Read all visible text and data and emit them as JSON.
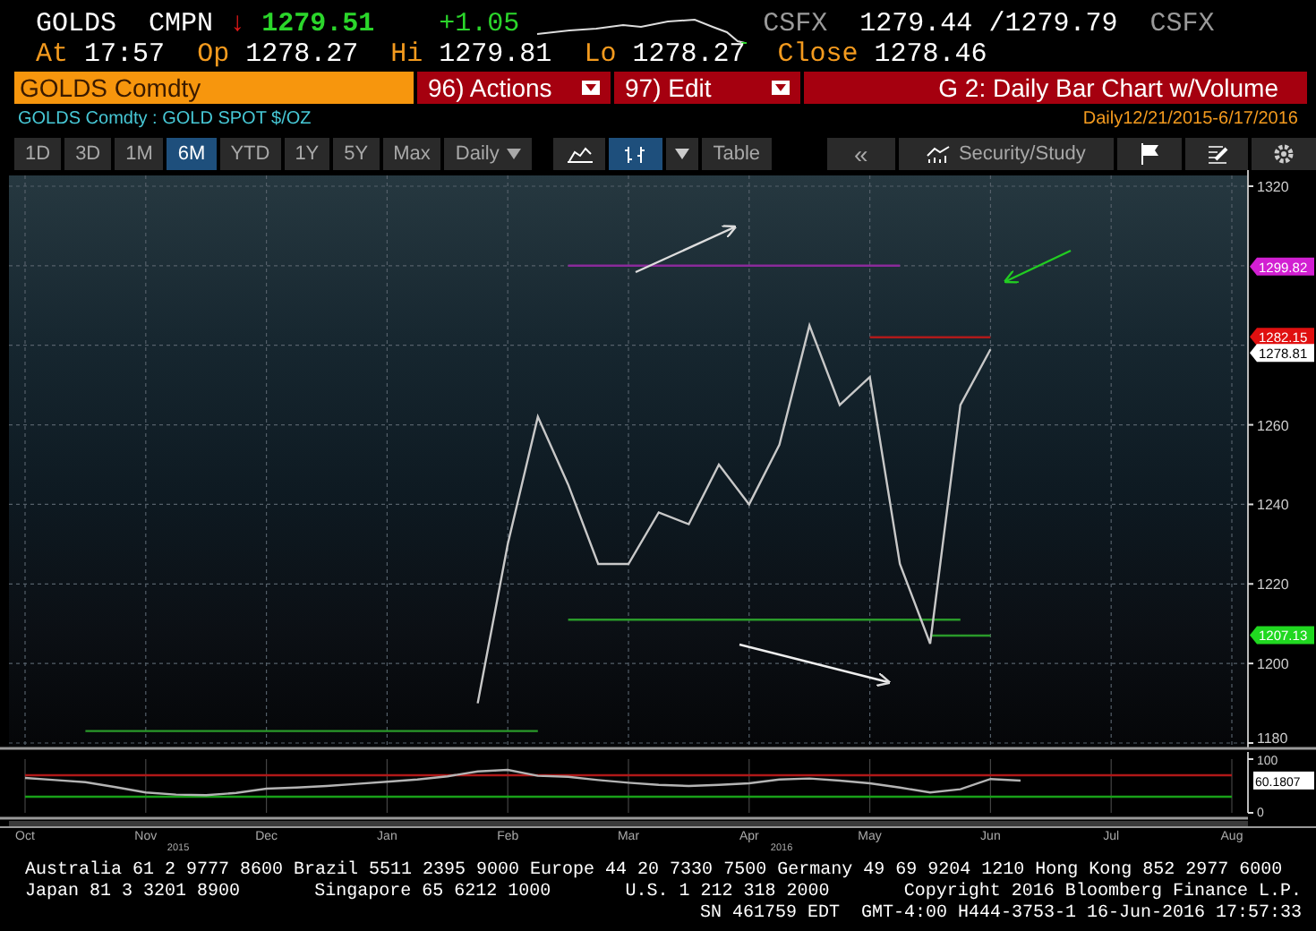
{
  "quote": {
    "ticker": "GOLDS",
    "source": "CMPN",
    "direction_arrow": "↓",
    "last": "1279.51",
    "change": "+1.05",
    "bid_source": "CSFX",
    "bid": "1279.44",
    "ask": "/1279.79",
    "ask_source": "CSFX"
  },
  "stats": [
    {
      "label": "At",
      "value": "17:57"
    },
    {
      "label": "Op",
      "value": "1278.27"
    },
    {
      "label": "Hi",
      "value": "1279.81"
    },
    {
      "label": "Lo",
      "value": "1278.27"
    },
    {
      "label": "Close",
      "value": "1278.46"
    }
  ],
  "command_bar": {
    "security": "GOLDS Comdty",
    "menus": [
      {
        "number": "96)",
        "label": "Actions"
      },
      {
        "number": "97)",
        "label": "Edit"
      }
    ],
    "title": "G 2: Daily Bar Chart w/Volume"
  },
  "description": "GOLDS Comdty : GOLD SPOT $/OZ",
  "period": {
    "label": "Daily",
    "range": "12/21/2015-6/17/2016"
  },
  "ranges": [
    {
      "label": "1D",
      "selected": false
    },
    {
      "label": "3D",
      "selected": false
    },
    {
      "label": "1M",
      "selected": false
    },
    {
      "label": "6M",
      "selected": true
    },
    {
      "label": "YTD",
      "selected": false
    },
    {
      "label": "1Y",
      "selected": false
    },
    {
      "label": "5Y",
      "selected": false
    },
    {
      "label": "Max",
      "selected": false
    }
  ],
  "frequency": "Daily",
  "chart_styles": [
    {
      "selected": false
    },
    {
      "selected": true
    }
  ],
  "table_button": "Table",
  "back_button": "«",
  "study_button": "Security/Study",
  "price_chart": {
    "price_tags": [
      {
        "value": "1299.82",
        "color": "#d21fd2"
      },
      {
        "value": "1282.15",
        "color": "#e01010"
      },
      {
        "value": "1278.81",
        "color": "#ffffff"
      },
      {
        "value": "1207.13",
        "color": "#20d820"
      }
    ],
    "chart_data": {
      "type": "line",
      "grid": true,
      "ylim": [
        1180,
        1320
      ],
      "yticks": [
        1180,
        1200,
        1220,
        1240,
        1260,
        1320
      ],
      "series": [
        {
          "color": "#c8c8c8",
          "values": [
            null,
            null,
            null,
            null,
            null,
            null,
            null,
            null,
            null,
            null,
            null,
            null,
            null,
            null,
            null,
            1190,
            1230,
            1262,
            1245,
            1225,
            1225,
            1238,
            1235,
            1250,
            1240,
            1255,
            1285,
            1265,
            1272,
            1225,
            1205,
            1265,
            1279,
            null,
            null,
            null,
            null,
            null,
            null,
            null,
            null
          ]
        },
        {
          "color": "#2a9a2a",
          "values": [
            null,
            null,
            1183,
            1183,
            1183,
            1183,
            1183,
            1183,
            1183,
            1183,
            1183,
            1183,
            1183,
            1183,
            1183,
            1183,
            1183,
            1183,
            null,
            null,
            null,
            null,
            null,
            null,
            null,
            null,
            null,
            null,
            null,
            null,
            null,
            null,
            null,
            null,
            null,
            null,
            null,
            null,
            null,
            null,
            null
          ]
        },
        {
          "color": "#8a2a9a",
          "values": [
            null,
            null,
            null,
            null,
            null,
            null,
            null,
            null,
            null,
            null,
            null,
            null,
            null,
            null,
            null,
            null,
            null,
            null,
            1300,
            1300,
            1300,
            1300,
            1300,
            1300,
            1300,
            1300,
            1300,
            1300,
            1300,
            1300,
            null,
            null,
            null,
            null,
            null,
            null,
            null,
            null,
            null,
            null,
            null
          ]
        },
        {
          "color": "#2a9a2a",
          "values": [
            null,
            null,
            null,
            null,
            null,
            null,
            null,
            null,
            null,
            null,
            null,
            null,
            null,
            null,
            null,
            null,
            null,
            null,
            1211,
            1211,
            1211,
            1211,
            1211,
            1211,
            1211,
            1211,
            1211,
            1211,
            1211,
            1211,
            1211,
            1211,
            null,
            null,
            null,
            null,
            null,
            null,
            null,
            null,
            null
          ]
        },
        {
          "color": "#2a9a2a",
          "values": [
            null,
            null,
            null,
            null,
            null,
            null,
            null,
            null,
            null,
            null,
            null,
            null,
            null,
            null,
            null,
            null,
            null,
            null,
            null,
            null,
            null,
            null,
            null,
            null,
            null,
            null,
            null,
            null,
            null,
            null,
            1207,
            1207,
            1207,
            null,
            null,
            null,
            null,
            null,
            null,
            null,
            null
          ]
        },
        {
          "color": "#b01a1a",
          "values": [
            null,
            null,
            null,
            null,
            null,
            null,
            null,
            null,
            null,
            null,
            null,
            null,
            null,
            null,
            null,
            null,
            null,
            null,
            null,
            null,
            null,
            null,
            null,
            null,
            null,
            null,
            null,
            null,
            1282,
            1282,
            1282,
            1282,
            1282,
            null,
            null,
            null,
            null,
            null,
            null,
            null,
            null
          ]
        }
      ]
    }
  },
  "indicator": {
    "reading": "60.1807",
    "chart_data": {
      "type": "line",
      "grid": true,
      "ylim": [
        0,
        100
      ],
      "yticks": [
        0,
        100
      ],
      "categories": [
        "Oct",
        null,
        null,
        null,
        "Nov",
        null,
        null,
        null,
        "Dec",
        null,
        null,
        null,
        "Jan",
        null,
        null,
        null,
        "Feb",
        null,
        null,
        null,
        "Mar",
        null,
        null,
        null,
        "Apr",
        null,
        null,
        null,
        "May",
        null,
        null,
        null,
        "Jun",
        null,
        null,
        null,
        "Jul",
        null,
        null,
        null,
        "Aug"
      ],
      "series": [
        {
          "color": "#b4b4b4",
          "values": [
            65,
            61,
            57,
            48,
            38,
            34,
            33,
            37,
            45,
            47,
            50,
            54,
            58,
            62,
            68,
            77,
            80,
            69,
            67,
            61,
            56,
            52,
            50,
            52,
            55,
            62,
            64,
            60,
            55,
            47,
            38,
            44,
            63,
            60,
            null,
            null,
            null,
            null,
            null,
            null,
            null
          ]
        },
        {
          "color": "#b01818",
          "values": [
            70,
            70,
            70,
            70,
            70,
            70,
            70,
            70,
            70,
            70,
            70,
            70,
            70,
            70,
            70,
            70,
            70,
            70,
            70,
            70,
            70,
            70,
            70,
            70,
            70,
            70,
            70,
            70,
            70,
            70,
            70,
            70,
            70,
            70,
            70,
            70,
            70,
            70,
            70,
            70,
            70
          ]
        },
        {
          "color": "#18a018",
          "values": [
            30,
            30,
            30,
            30,
            30,
            30,
            30,
            30,
            30,
            30,
            30,
            30,
            30,
            30,
            30,
            30,
            30,
            30,
            30,
            30,
            30,
            30,
            30,
            30,
            30,
            30,
            30,
            30,
            30,
            30,
            30,
            30,
            30,
            30,
            30,
            30,
            30,
            30,
            30,
            30,
            30
          ]
        }
      ]
    },
    "years": [
      "2015",
      "2016"
    ]
  },
  "footer": [
    [
      "Australia 61 2 9777 8600 Brazil 5511 2395 9000 Europe 44 20 7330 7500 Germany 49 69 9204 1210 Hong Kong 852 2977 6000"
    ],
    [
      "Japan 81 3 3201 8900",
      "Singapore 65 6212 1000",
      "U.S. 1 212 318 2000",
      "Copyright 2016 Bloomberg Finance L.P."
    ],
    [
      "SN 461759 EDT  GMT-4:00 H444-3753-1 16-Jun-2016 17:57:33"
    ]
  ]
}
